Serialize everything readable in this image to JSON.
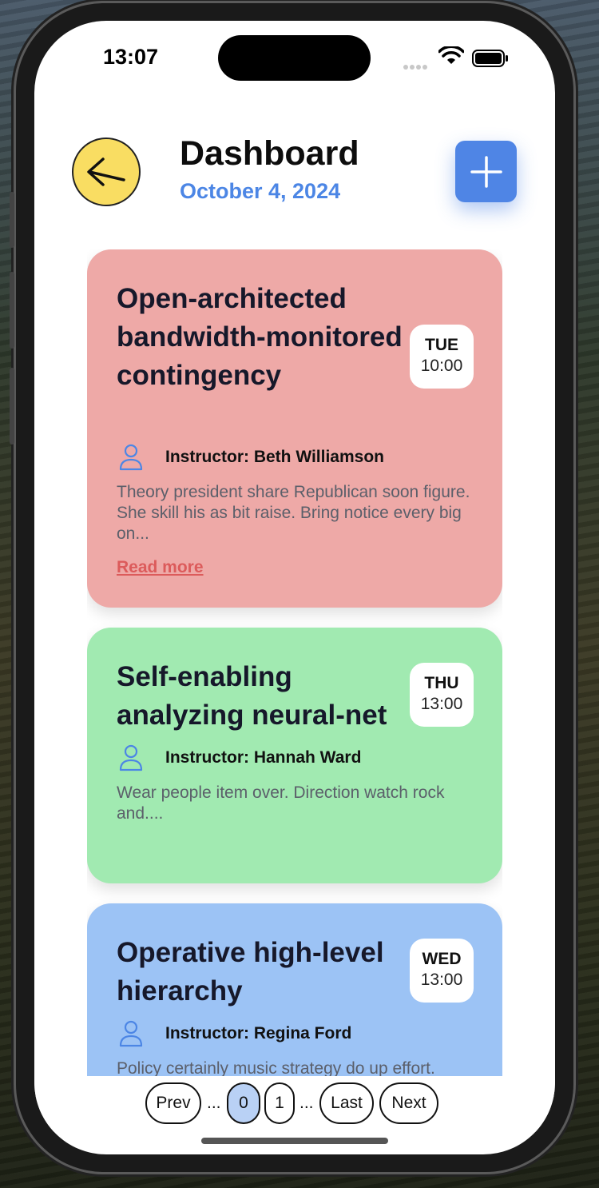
{
  "status_bar": {
    "time": "13:07"
  },
  "header": {
    "title": "Dashboard",
    "date": "October 4, 2024"
  },
  "courses": [
    {
      "title": "Open-architected bandwidth-monitored contingency",
      "day": "TUE",
      "time": "10:00",
      "instructor": "Instructor: Beth Williamson",
      "description": "Theory president share Republican soon figure. She skill his as bit raise. Bring notice every big on...",
      "read_more": "Read more",
      "color": "#eea9a7"
    },
    {
      "title": "Self-enabling analyzing neural-net",
      "day": "THU",
      "time": "13:00",
      "instructor": "Instructor: Hannah Ward",
      "description": "Wear people item over. Direction watch rock and....",
      "color": "#a1eab1"
    },
    {
      "title": "Operative high-level hierarchy",
      "day": "WED",
      "time": "13:00",
      "instructor": "Instructor: Regina Ford",
      "description": "Policy certainly music strategy do up effort.",
      "color": "#9cc3f5"
    }
  ],
  "pagination": {
    "prev": "Prev",
    "ellipsis": "...",
    "pages": [
      "0",
      "1"
    ],
    "last": "Last",
    "next": "Next",
    "current": "0"
  },
  "colors": {
    "accent": "#4f85e5",
    "back_button": "#f9dd62",
    "read_more": "#dc5b5b",
    "active_page": "#b9d1f5"
  },
  "icons": {
    "back": "arrow-left-icon",
    "add": "plus-icon",
    "instructor": "person-icon"
  }
}
